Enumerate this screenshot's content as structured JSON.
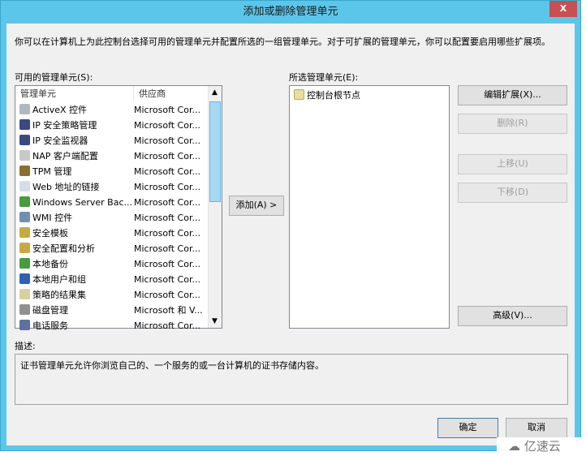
{
  "window": {
    "title": "添加或删除管理单元",
    "close_label": "X"
  },
  "intro": "你可以在计算机上为此控制台选择可用的管理单元并配置所选的一组管理单元。对于可扩展的管理单元，你可以配置要启用哪些扩展项。",
  "available": {
    "label": "可用的管理单元(S):",
    "columns": [
      "管理单元",
      "供应商"
    ],
    "items": [
      {
        "name": "ActiveX 控件",
        "vendor": "Microsoft Cor...",
        "icon": "activex-icon",
        "color": "#b0b8c0"
      },
      {
        "name": "IP 安全策略管理",
        "vendor": "Microsoft Cor...",
        "icon": "ip-security-icon",
        "color": "#3a4a80"
      },
      {
        "name": "IP 安全监视器",
        "vendor": "Microsoft Cor...",
        "icon": "ip-monitor-icon",
        "color": "#3a4a80"
      },
      {
        "name": "NAP 客户端配置",
        "vendor": "Microsoft Cor...",
        "icon": "nap-icon",
        "color": "#c8c8c8"
      },
      {
        "name": "TPM 管理",
        "vendor": "Microsoft Cor...",
        "icon": "tpm-icon",
        "color": "#8a7030"
      },
      {
        "name": "Web 地址的链接",
        "vendor": "Microsoft Cor...",
        "icon": "web-link-icon",
        "color": "#d8dce8"
      },
      {
        "name": "Windows Server Bac...",
        "vendor": "Microsoft Cor...",
        "icon": "backup-icon",
        "color": "#4a9a40"
      },
      {
        "name": "WMI 控件",
        "vendor": "Microsoft Cor...",
        "icon": "wmi-icon",
        "color": "#7090b0"
      },
      {
        "name": "安全模板",
        "vendor": "Microsoft Cor...",
        "icon": "security-template-icon",
        "color": "#c8a840"
      },
      {
        "name": "安全配置和分析",
        "vendor": "Microsoft Cor...",
        "icon": "security-analysis-icon",
        "color": "#c8a840"
      },
      {
        "name": "本地备份",
        "vendor": "Microsoft Cor...",
        "icon": "local-backup-icon",
        "color": "#4a9a40"
      },
      {
        "name": "本地用户和组",
        "vendor": "Microsoft Cor...",
        "icon": "users-icon",
        "color": "#3060b0"
      },
      {
        "name": "策略的结果集",
        "vendor": "Microsoft Cor...",
        "icon": "rsop-icon",
        "color": "#d8d0a0"
      },
      {
        "name": "磁盘管理",
        "vendor": "Microsoft 和 V...",
        "icon": "disk-icon",
        "color": "#909090"
      },
      {
        "name": "电话服务",
        "vendor": "Microsoft Cor...",
        "icon": "telephony-icon",
        "color": "#6070a0"
      }
    ]
  },
  "add_button": "添加(A) >",
  "selected": {
    "label": "所选管理单元(E):",
    "items": [
      {
        "name": "控制台根节点",
        "icon": "folder-icon"
      }
    ]
  },
  "side_buttons": {
    "edit": "编辑扩展(X)...",
    "remove": "删除(R)",
    "up": "上移(U)",
    "down": "下移(D)",
    "advanced": "高级(V)..."
  },
  "description": {
    "label": "描述:",
    "text": "证书管理单元允许你浏览自己的、一个服务的或一台计算机的证书存储内容。"
  },
  "footer": {
    "ok": "确定",
    "cancel": "取消"
  },
  "watermark": "亿速云"
}
